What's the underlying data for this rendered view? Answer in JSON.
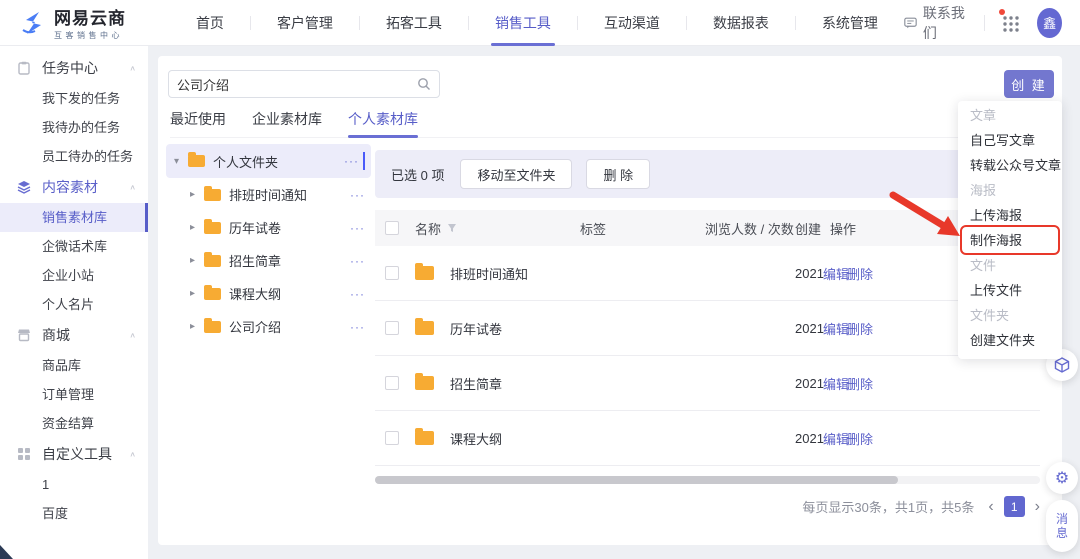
{
  "header": {
    "logo": {
      "title": "网易云商",
      "subtitle": "互客销售中心"
    },
    "nav": [
      "首页",
      "客户管理",
      "拓客工具",
      "销售工具",
      "互动渠道",
      "数据报表",
      "系统管理"
    ],
    "contact": "联系我们",
    "avatar": "鑫"
  },
  "sidebar": {
    "sections": [
      {
        "label": "任务中心",
        "items": [
          "我下发的任务",
          "我待办的任务",
          "员工待办的任务"
        ]
      },
      {
        "label": "内容素材",
        "items": [
          "销售素材库",
          "企微话术库",
          "企业小站",
          "个人名片"
        ]
      },
      {
        "label": "商城",
        "items": [
          "商品库",
          "订单管理",
          "资金结算"
        ]
      },
      {
        "label": "自定义工具",
        "items": [
          "1",
          "百度"
        ]
      }
    ]
  },
  "content": {
    "search": {
      "value": "公司介绍"
    },
    "create_button": "创 建",
    "tabs": [
      "最近使用",
      "企业素材库",
      "个人素材库"
    ],
    "tree": {
      "root": "个人文件夹",
      "children": [
        "排班时间通知",
        "历年试卷",
        "招生简章",
        "课程大纲",
        "公司介绍"
      ]
    },
    "toolbar": {
      "selected": "已选 0 项",
      "move": "移动至文件夹",
      "delete": "删 除"
    },
    "table": {
      "headers": {
        "name": "名称",
        "tag": "标签",
        "views": "浏览人数 / 次数",
        "created": "创建",
        "actions": "操作"
      },
      "rows": [
        {
          "name": "排班时间通知",
          "created": "2021"
        },
        {
          "name": "历年试卷",
          "created": "2021"
        },
        {
          "name": "招生简章",
          "created": "2021"
        },
        {
          "name": "课程大纲",
          "created": "2021"
        }
      ],
      "row_actions": {
        "edit": "编辑",
        "delete": "删除"
      }
    },
    "pagination": {
      "summary": "每页显示30条，共1页，共5条",
      "page": "1"
    }
  },
  "dropdown": {
    "groups": [
      {
        "label": "文章",
        "items": [
          "自己写文章",
          "转载公众号文章"
        ]
      },
      {
        "label": "海报",
        "items": [
          "上传海报",
          "制作海报"
        ]
      },
      {
        "label": "文件",
        "items": [
          "上传文件"
        ]
      },
      {
        "label": "文件夹",
        "items": [
          "创建文件夹"
        ]
      }
    ],
    "highlighted_item": "制作海报"
  },
  "floating": {
    "message_line1": "消",
    "message_line2": "息"
  },
  "icons": {
    "more": "···",
    "caret_down": "▾",
    "caret_right": "▸",
    "collapse": "∧",
    "prev": "‹",
    "next": "›",
    "gear": "⚙",
    "filter_col": "名称"
  },
  "colors": {
    "accent": "#6a6fd4",
    "highlight": "#ececf8",
    "annotation": "#e8382a",
    "folder": "#f7ab33",
    "page_bg": "#eef0f4"
  }
}
